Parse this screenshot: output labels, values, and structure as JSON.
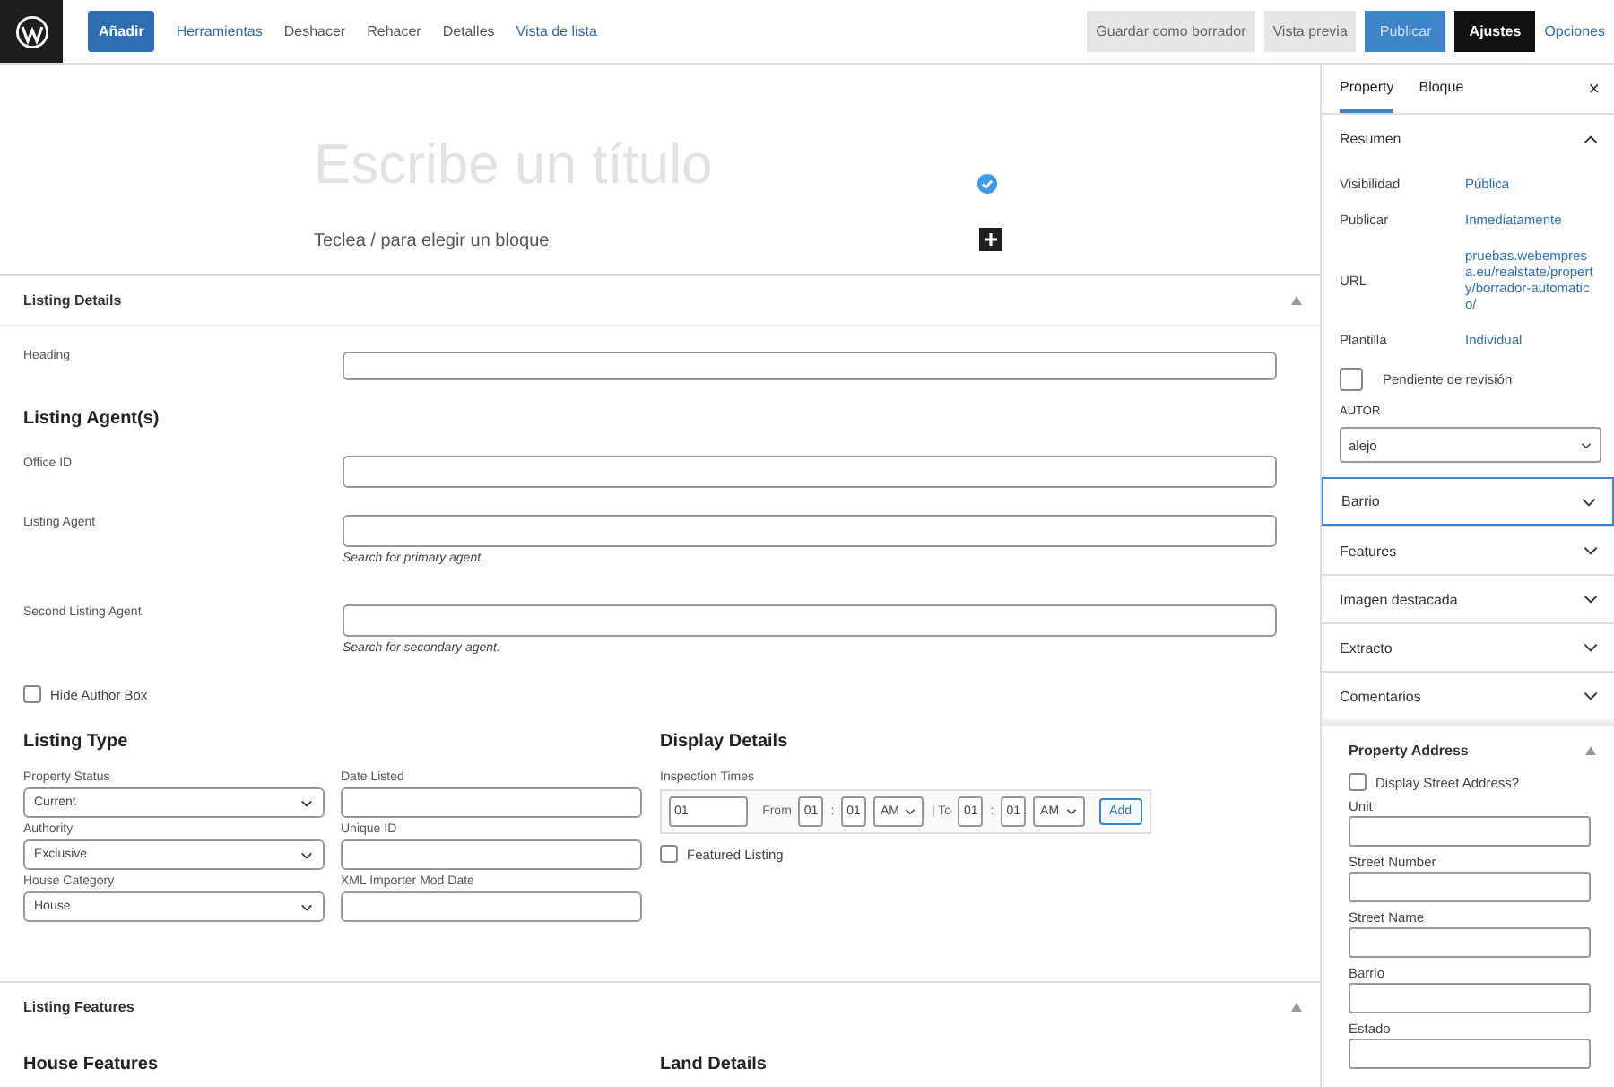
{
  "toolbar": {
    "add_button": "Añadir",
    "items": [
      {
        "label": "Herramientas",
        "kind": "link"
      },
      {
        "label": "Deshacer",
        "kind": "plain"
      },
      {
        "label": "Rehacer",
        "kind": "plain"
      },
      {
        "label": "Detalles",
        "kind": "plain"
      },
      {
        "label": "Vista de lista",
        "kind": "link"
      }
    ],
    "save_draft": "Guardar como borrador",
    "preview": "Vista previa",
    "publish": "Publicar",
    "settings": {
      "label": "Ajustes",
      "selected": true
    },
    "options": "Opciones"
  },
  "editor": {
    "title_placeholder": "Escribe un título",
    "block_placeholder": "Teclea / para elegir un bloque"
  },
  "listing_details": {
    "title": "Listing Details",
    "expanded": true,
    "heading_label": "Heading",
    "agents_title": "Listing Agent(s)",
    "fields": [
      {
        "label": "Office ID"
      },
      {
        "label": "Listing Agent",
        "hint": "Search for primary agent."
      },
      {
        "label": "Second Listing Agent",
        "hint": "Search for secondary agent."
      }
    ],
    "hide_author": {
      "label": "Hide Author Box",
      "checked": false
    }
  },
  "listing_type": {
    "title": "Listing Type",
    "fields": [
      {
        "label": "Property Status",
        "kind": "select",
        "value": "Current"
      },
      {
        "label": "Date Listed",
        "kind": "text"
      },
      {
        "label": "Authority",
        "kind": "select",
        "value": "Exclusive"
      },
      {
        "label": "Unique ID",
        "kind": "text"
      },
      {
        "label": "House Category",
        "kind": "select",
        "value": "House"
      },
      {
        "label": "XML Importer Mod Date",
        "kind": "text"
      }
    ]
  },
  "display_details": {
    "title": "Display Details",
    "inspection_label": "Inspection Times",
    "date_value": "01",
    "from_label": "From",
    "from": {
      "hour": "01",
      "separator": ":",
      "minute": "01",
      "period": "AM"
    },
    "to_label": "| To",
    "to": {
      "hour": "01",
      "separator": ":",
      "minute": "01",
      "period": "AM"
    },
    "add_button": "Add",
    "featured": {
      "label": "Featured Listing",
      "checked": false
    }
  },
  "listing_features": {
    "title": "Listing Features",
    "expanded": true,
    "house_features_title": "House Features",
    "land_details_title": "Land Details"
  },
  "sidebar": {
    "tabs": [
      {
        "label": "Property",
        "selected": true
      },
      {
        "label": "Bloque",
        "selected": false
      }
    ],
    "close": "×",
    "summary": {
      "title": "Resumen",
      "expanded": true,
      "rows": [
        {
          "label": "Visibilidad",
          "value": "Pública"
        },
        {
          "label": "Publicar",
          "value": "Inmediatamente"
        },
        {
          "label": "URL",
          "value": "pruebas.webempresa.eu/realstate/property/borrador-automatico/"
        },
        {
          "label": "Plantilla",
          "value": "Individual"
        }
      ],
      "pending": {
        "label": "Pendiente de revisión",
        "checked": false
      },
      "author_label": "AUTOR",
      "author_value": "alejo"
    },
    "panels": [
      {
        "title": "Barrio",
        "expanded": false,
        "focused": true
      },
      {
        "title": "Features",
        "expanded": false,
        "focused": false
      },
      {
        "title": "Imagen destacada",
        "expanded": false,
        "focused": false
      },
      {
        "title": "Extracto",
        "expanded": false,
        "focused": false
      },
      {
        "title": "Comentarios",
        "expanded": false,
        "focused": false
      }
    ],
    "property_address": {
      "title": "Property Address",
      "expanded": true,
      "display_street": {
        "label": "Display Street Address?",
        "checked": false
      },
      "fields": [
        "Unit",
        "Street Number",
        "Street Name",
        "Barrio",
        "Estado"
      ]
    }
  }
}
